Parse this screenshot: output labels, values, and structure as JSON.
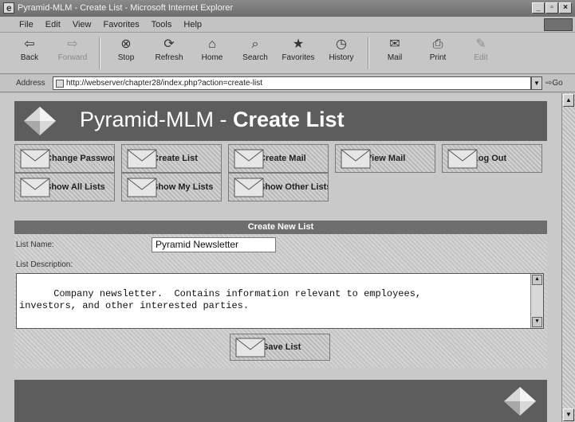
{
  "window": {
    "title": "Pyramid-MLM - Create List - Microsoft Internet Explorer",
    "controls": [
      "_",
      "▫",
      "×"
    ]
  },
  "menu": [
    "File",
    "Edit",
    "View",
    "Favorites",
    "Tools",
    "Help"
  ],
  "toolbar": [
    {
      "label": "Back",
      "icon": "back-arrow-icon",
      "glyph": "⇦",
      "enabled": true
    },
    {
      "label": "Forward",
      "icon": "forward-arrow-icon",
      "glyph": "⇨",
      "enabled": false
    },
    {
      "label": "Stop",
      "icon": "stop-icon",
      "glyph": "⊗",
      "enabled": true
    },
    {
      "label": "Refresh",
      "icon": "refresh-icon",
      "glyph": "⟳",
      "enabled": true
    },
    {
      "label": "Home",
      "icon": "home-icon",
      "glyph": "⌂",
      "enabled": true
    },
    {
      "label": "Search",
      "icon": "search-icon",
      "glyph": "⌕",
      "enabled": true
    },
    {
      "label": "Favorites",
      "icon": "favorites-icon",
      "glyph": "★",
      "enabled": true
    },
    {
      "label": "History",
      "icon": "history-icon",
      "glyph": "◷",
      "enabled": true
    },
    {
      "label": "Mail",
      "icon": "mail-icon",
      "glyph": "✉",
      "enabled": true
    },
    {
      "label": "Print",
      "icon": "print-icon",
      "glyph": "⎙",
      "enabled": true
    },
    {
      "label": "Edit",
      "icon": "edit-icon",
      "glyph": "✎",
      "enabled": false
    }
  ],
  "address": {
    "label": "Address",
    "url": "http://webserver/chapter28/index.php?action=create-list",
    "go": "Go"
  },
  "page": {
    "title_light": "Pyramid-MLM - ",
    "title_bold": "Create List"
  },
  "nav": {
    "row1": [
      "Change Password",
      "Create List",
      "Create Mail",
      "View Mail",
      "Log Out"
    ],
    "row2": [
      "Show All Lists",
      "Show My Lists",
      "Show Other Lists"
    ]
  },
  "form": {
    "header": "Create New List",
    "name_label": "List Name:",
    "name_value": "Pyramid Newsletter",
    "desc_label": "List Description:",
    "desc_value": "Company newsletter.  Contains information relevant to employees,\ninvestors, and other interested parties.",
    "save_label": "Save List"
  }
}
